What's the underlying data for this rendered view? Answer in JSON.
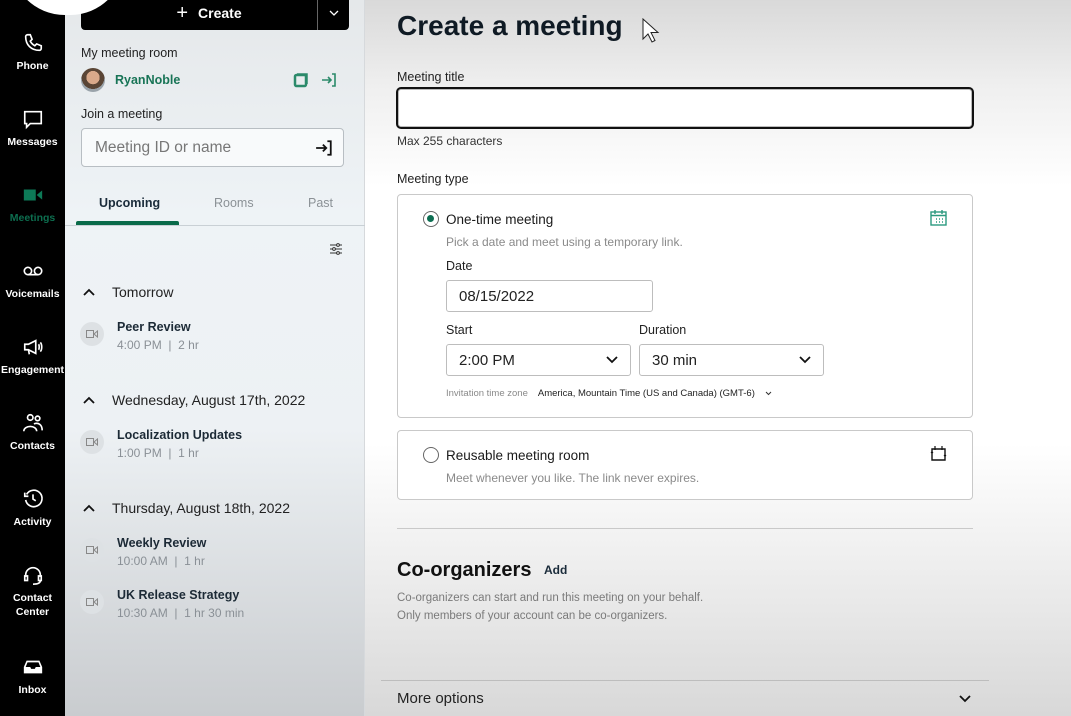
{
  "nav": {
    "items": [
      {
        "label": "Phone",
        "icon": "phone-icon"
      },
      {
        "label": "Messages",
        "icon": "chat-bubble-icon"
      },
      {
        "label": "Meetings",
        "icon": "video-camera-icon",
        "active": true
      },
      {
        "label": "Voicemails",
        "icon": "voicemail-icon"
      },
      {
        "label": "Engagement",
        "icon": "megaphone-icon"
      },
      {
        "label": "Contacts",
        "icon": "contacts-icon"
      },
      {
        "label": "Activity",
        "icon": "history-clock-icon"
      },
      {
        "label": "Contact Center",
        "label_line1": "Contact",
        "label_line2": "Center",
        "icon": "headset-icon"
      },
      {
        "label": "Inbox",
        "icon": "inbox-tray-icon"
      }
    ]
  },
  "sidebar": {
    "create_label": "Create",
    "my_room_label": "My meeting room",
    "room_name": "RyanNoble",
    "join_label": "Join a meeting",
    "join_placeholder": "Meeting ID or name",
    "tabs": [
      {
        "label": "Upcoming",
        "active": true
      },
      {
        "label": "Rooms"
      },
      {
        "label": "Past"
      }
    ],
    "groups": [
      {
        "header": "Tomorrow",
        "meetings": [
          {
            "title": "Peer Review",
            "time": "4:00 PM",
            "duration": "2 hr",
            "detail": "4:00 PM  |  2 hr"
          }
        ]
      },
      {
        "header": "Wednesday, August 17th, 2022",
        "meetings": [
          {
            "title": "Localization Updates",
            "time": "1:00 PM",
            "duration": "1 hr",
            "detail": "1:00 PM  |  1 hr"
          }
        ]
      },
      {
        "header": "Thursday, August 18th, 2022",
        "meetings": [
          {
            "title": "Weekly Review",
            "time": "10:00 AM",
            "duration": "1 hr",
            "detail": "10:00 AM  |  1 hr"
          },
          {
            "title": "UK Release Strategy",
            "time": "10:30 AM",
            "duration": "1 hr 30 min",
            "detail": "10:30 AM  |  1 hr 30 min"
          }
        ]
      }
    ]
  },
  "main": {
    "title": "Create a meeting",
    "meeting_title_label": "Meeting title",
    "meeting_title_value": "",
    "meeting_title_hint": "Max 255 characters",
    "meeting_type_label": "Meeting type",
    "one_time": {
      "title": "One-time meeting",
      "description": "Pick a date and meet using a temporary link.",
      "selected": true,
      "date_label": "Date",
      "date_value": "08/15/2022",
      "start_label": "Start",
      "start_value": "2:00 PM",
      "duration_label": "Duration",
      "duration_value": "30 min",
      "timezone_label": "Invitation time zone",
      "timezone_value": "America, Mountain Time (US and Canada) (GMT-6)"
    },
    "reusable": {
      "title": "Reusable meeting room",
      "description": "Meet whenever you like. The link never expires.",
      "selected": false
    },
    "coorganizers": {
      "title": "Co-organizers",
      "add_label": "Add",
      "desc_line1": "Co-organizers can start and run this meeting on your behalf.",
      "desc_line2": "Only members of your account can be co-organizers."
    },
    "more_options_label": "More options"
  },
  "colors": {
    "accent": "#0d6e52",
    "rail_bg": "#000000"
  }
}
